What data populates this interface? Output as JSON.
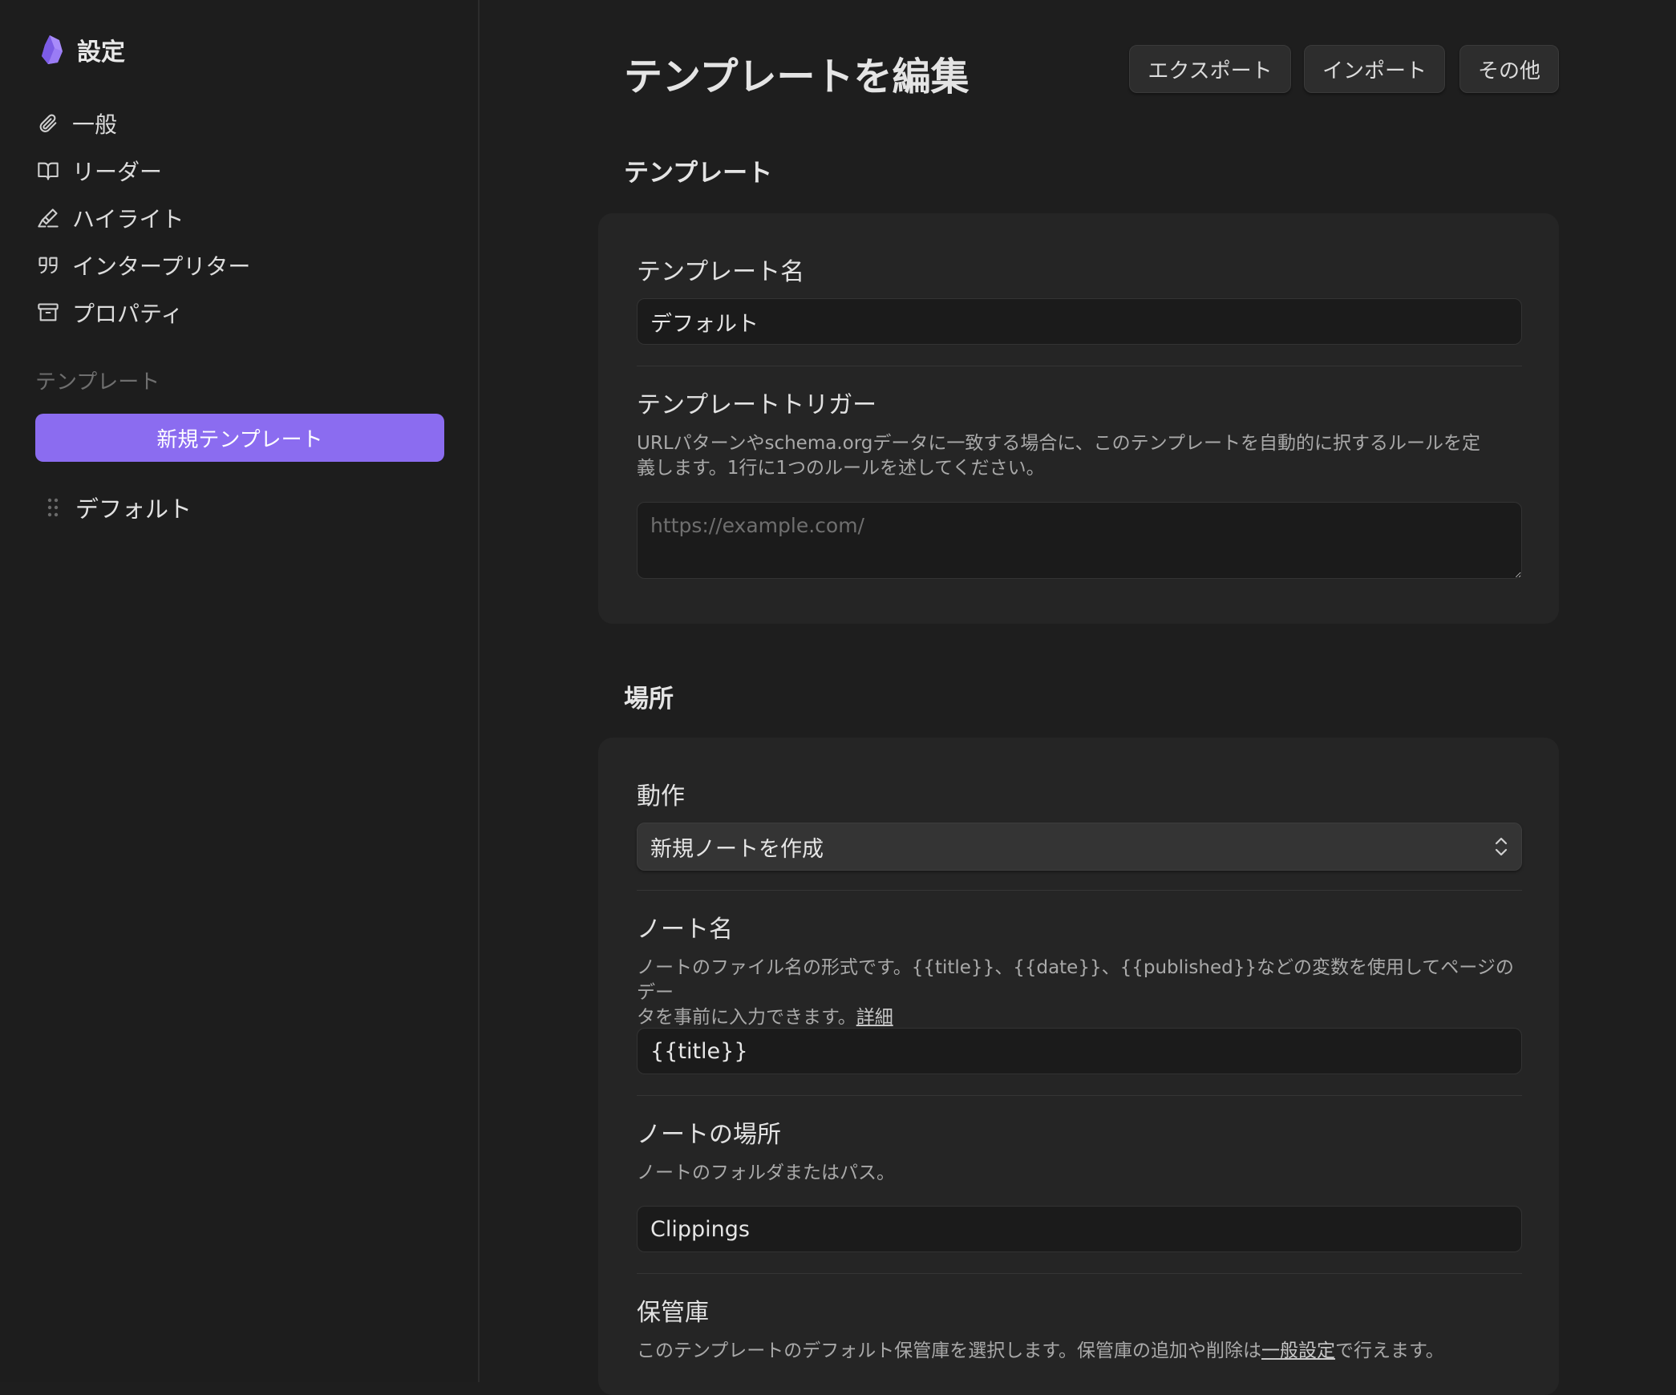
{
  "sidebar": {
    "title": "設定",
    "nav": [
      {
        "label": "一般",
        "icon": "paperclip-icon"
      },
      {
        "label": "リーダー",
        "icon": "book-open-icon"
      },
      {
        "label": "ハイライト",
        "icon": "highlighter-icon"
      },
      {
        "label": "インタープリター",
        "icon": "quote-icon"
      },
      {
        "label": "プロパティ",
        "icon": "archive-icon"
      }
    ],
    "section_label": "テンプレート",
    "new_template_label": "新規テンプレート",
    "templates": [
      "デフォルト"
    ]
  },
  "header": {
    "title": "テンプレートを編集",
    "export_label": "エクスポート",
    "import_label": "インポート",
    "more_label": "その他"
  },
  "template_section": {
    "heading": "テンプレート",
    "name_label": "テンプレート名",
    "name_value": "デフォルト",
    "trigger_label": "テンプレートトリガー",
    "trigger_desc_line1": "URLパターンやschema.orgデータに一致する場合に、このテンプレートを自動的に択するルールを定",
    "trigger_desc_line2": "義します。1行に1つのルールを述してください。",
    "trigger_placeholder": "https://example.com/"
  },
  "location_section": {
    "heading": "場所",
    "action_label": "動作",
    "action_value": "新規ノートを作成",
    "note_name_label": "ノート名",
    "note_name_desc_line1": "ノートのファイル名の形式です。{{title}}、{{date}}、{{published}}などの変数を使用してページのデー",
    "note_name_desc_line2": "タを事前に入力できます。",
    "note_name_desc_link": "詳細",
    "note_name_value": "{{title}}",
    "note_location_label": "ノートの場所",
    "note_location_desc": "ノートのフォルダまたはパス。",
    "note_location_value": "Clippings",
    "vault_label": "保管庫",
    "vault_desc_prefix": "このテンプレートのデフォルト保管庫を選択します。保管庫の追加や削除は",
    "vault_desc_link": "一般設定",
    "vault_desc_suffix": "で行えます。"
  },
  "colors": {
    "accent": "#8b6cf0",
    "background": "#1e1e1e",
    "card": "#252525"
  }
}
